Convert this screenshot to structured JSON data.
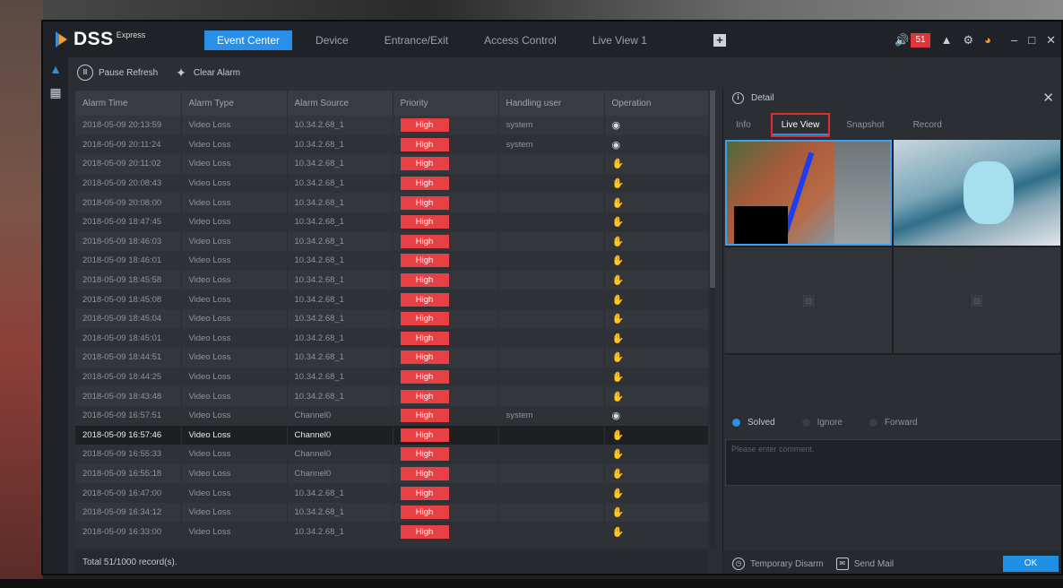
{
  "app": {
    "brand": "DSS",
    "brand_sup": "Express"
  },
  "nav": {
    "tabs": [
      "Event Center",
      "Device",
      "Entrance/Exit",
      "Access Control",
      "Live View 1"
    ],
    "active_index": 0
  },
  "topbar": {
    "alarm_count": "51",
    "plus_icon": "plus-icon",
    "sound_icon": "speaker-icon",
    "user_icon": "user-icon",
    "settings_icon": "gear-icon",
    "perf_icon": "gauge-icon"
  },
  "rail": {
    "items": [
      {
        "icon": "alarm-triangle-icon",
        "active": true
      },
      {
        "icon": "event-search-icon",
        "active": false
      }
    ]
  },
  "toolbar": {
    "pause_label": "Pause Refresh",
    "clear_label": "Clear Alarm"
  },
  "table": {
    "columns": [
      "Alarm Time",
      "Alarm Type",
      "Alarm Source",
      "Priority",
      "Handling user",
      "Operation"
    ],
    "rows": [
      {
        "time": "2018-05-09 20:13:59",
        "type": "Video Loss",
        "source": "10.34.2.68_1",
        "priority": "High",
        "user": "system",
        "op": "eye"
      },
      {
        "time": "2018-05-09 20:11:24",
        "type": "Video Loss",
        "source": "10.34.2.68_1",
        "priority": "High",
        "user": "system",
        "op": "eye"
      },
      {
        "time": "2018-05-09 20:11:02",
        "type": "Video Loss",
        "source": "10.34.2.68_1",
        "priority": "High",
        "user": "",
        "op": "hand"
      },
      {
        "time": "2018-05-09 20:08:43",
        "type": "Video Loss",
        "source": "10.34.2.68_1",
        "priority": "High",
        "user": "",
        "op": "hand"
      },
      {
        "time": "2018-05-09 20:08:00",
        "type": "Video Loss",
        "source": "10.34.2.68_1",
        "priority": "High",
        "user": "",
        "op": "hand"
      },
      {
        "time": "2018-05-09 18:47:45",
        "type": "Video Loss",
        "source": "10.34.2.68_1",
        "priority": "High",
        "user": "",
        "op": "hand"
      },
      {
        "time": "2018-05-09 18:46:03",
        "type": "Video Loss",
        "source": "10.34.2.68_1",
        "priority": "High",
        "user": "",
        "op": "hand"
      },
      {
        "time": "2018-05-09 18:46:01",
        "type": "Video Loss",
        "source": "10.34.2.68_1",
        "priority": "High",
        "user": "",
        "op": "hand"
      },
      {
        "time": "2018-05-09 18:45:58",
        "type": "Video Loss",
        "source": "10.34.2.68_1",
        "priority": "High",
        "user": "",
        "op": "hand"
      },
      {
        "time": "2018-05-09 18:45:08",
        "type": "Video Loss",
        "source": "10.34.2.68_1",
        "priority": "High",
        "user": "",
        "op": "hand"
      },
      {
        "time": "2018-05-09 18:45:04",
        "type": "Video Loss",
        "source": "10.34.2.68_1",
        "priority": "High",
        "user": "",
        "op": "hand"
      },
      {
        "time": "2018-05-09 18:45:01",
        "type": "Video Loss",
        "source": "10.34.2.68_1",
        "priority": "High",
        "user": "",
        "op": "hand"
      },
      {
        "time": "2018-05-09 18:44:51",
        "type": "Video Loss",
        "source": "10.34.2.68_1",
        "priority": "High",
        "user": "",
        "op": "hand"
      },
      {
        "time": "2018-05-09 18:44:25",
        "type": "Video Loss",
        "source": "10.34.2.68_1",
        "priority": "High",
        "user": "",
        "op": "hand"
      },
      {
        "time": "2018-05-09 18:43:48",
        "type": "Video Loss",
        "source": "10.34.2.68_1",
        "priority": "High",
        "user": "",
        "op": "hand"
      },
      {
        "time": "2018-05-09 16:57:51",
        "type": "Video Loss",
        "source": "Channel0",
        "priority": "High",
        "user": "system",
        "op": "eye"
      },
      {
        "time": "2018-05-09 16:57:46",
        "type": "Video Loss",
        "source": "Channel0",
        "priority": "High",
        "user": "",
        "op": "hand",
        "selected": true
      },
      {
        "time": "2018-05-09 16:55:33",
        "type": "Video Loss",
        "source": "Channel0",
        "priority": "High",
        "user": "",
        "op": "hand"
      },
      {
        "time": "2018-05-09 16:55:18",
        "type": "Video Loss",
        "source": "Channel0",
        "priority": "High",
        "user": "",
        "op": "hand"
      },
      {
        "time": "2018-05-09 16:47:00",
        "type": "Video Loss",
        "source": "10.34.2.68_1",
        "priority": "High",
        "user": "",
        "op": "hand"
      },
      {
        "time": "2018-05-09 16:34:12",
        "type": "Video Loss",
        "source": "10.34.2.68_1",
        "priority": "High",
        "user": "",
        "op": "hand"
      },
      {
        "time": "2018-05-09 16:33:00",
        "type": "Video Loss",
        "source": "10.34.2.68_1",
        "priority": "High",
        "user": "",
        "op": "hand"
      }
    ],
    "footer": "Total 51/1000 record(s)."
  },
  "detail": {
    "title": "Detail",
    "tabs": [
      "Info",
      "Live View",
      "Snapshot",
      "Record"
    ],
    "active_tab": 1,
    "radios": [
      {
        "label": "Solved",
        "checked": true
      },
      {
        "label": "Ignore",
        "checked": false
      },
      {
        "label": "Forward",
        "checked": false
      }
    ],
    "comment_placeholder": "Please enter comment.",
    "temp_disarm": "Temporary Disarm",
    "send_mail": "Send Mail",
    "ok": "OK"
  },
  "colors": {
    "accent": "#2a8fe8",
    "priority_high": "#e84145",
    "highlight_border": "#e02c2c"
  }
}
